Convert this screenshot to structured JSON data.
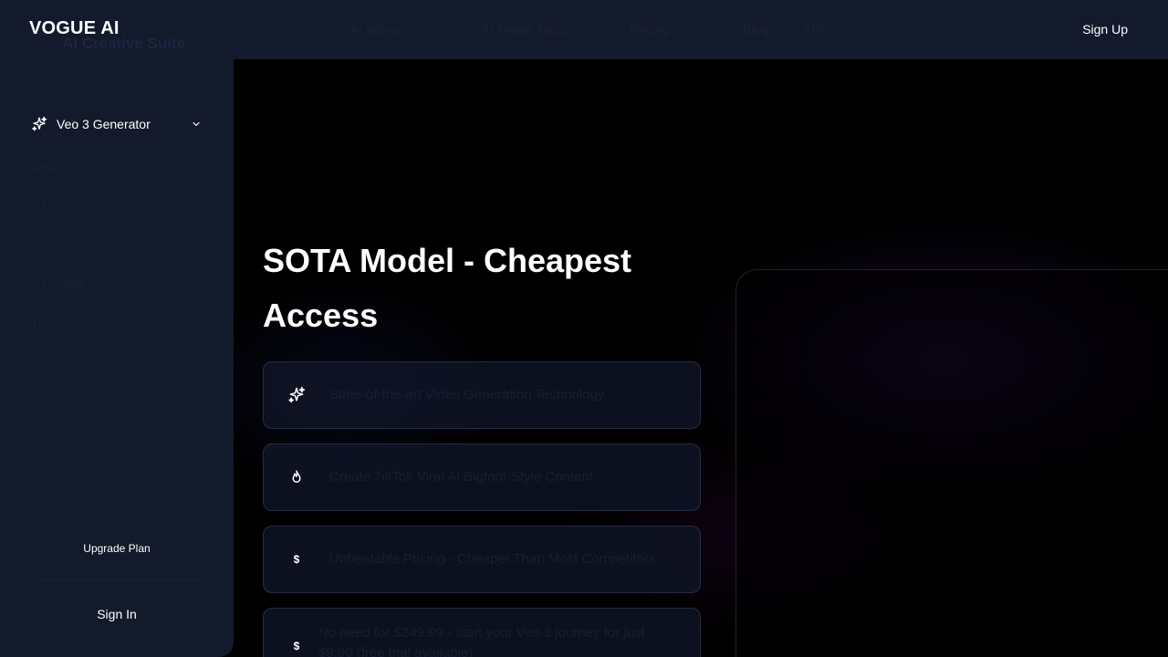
{
  "brand": {
    "name": "VOGUE AI"
  },
  "nav": {
    "ghost_links": [
      "AI Video",
      "AI Image Tools",
      "Pricing",
      "Blog",
      "API"
    ],
    "signup_label": "Sign Up"
  },
  "sidebar": {
    "ghost_title": "AI Creative Suite",
    "active_item": {
      "label": "Veo 3 Generator",
      "icon": "sparkles-icon",
      "expand_icon": "chevron-down-icon"
    },
    "ghost_items": [
      "Home",
      "AI Video",
      "AI Image",
      "Pricing"
    ],
    "upgrade_label": "Upgrade Plan",
    "signin_label": "Sign In"
  },
  "main": {
    "title": "SOTA Model - Cheapest Access",
    "features": [
      {
        "icon": "sparkles-icon",
        "glyph": "",
        "text": "State-of-the-art Video Generation Technology"
      },
      {
        "icon": "flame-icon",
        "glyph": "",
        "text": "Create TikTok Viral AI Bigfoot-Style Content"
      },
      {
        "icon": "dollar-icon",
        "glyph": "$",
        "text": "Unbeatable Pricing - Cheaper Than Most Competitors"
      },
      {
        "icon": "dollar-icon",
        "glyph": "$",
        "text": "No need for $249.99 - start your Veo 3 journey for just $9.90 (free trial available)"
      }
    ]
  },
  "colors": {
    "background": "#000000",
    "panel": "#131a2b",
    "card": "#111628",
    "card_border": "#262d42",
    "text": "#ffffff"
  }
}
